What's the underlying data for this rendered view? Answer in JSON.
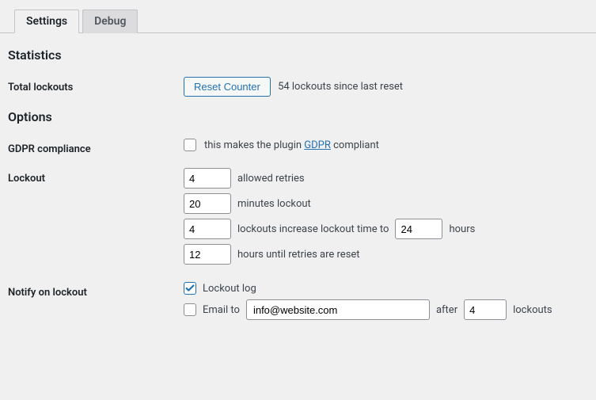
{
  "tabs": {
    "settings": "Settings",
    "debug": "Debug"
  },
  "sections": {
    "statistics": "Statistics",
    "options": "Options"
  },
  "total_lockouts": {
    "label": "Total lockouts",
    "button": "Reset Counter",
    "text": "54 lockouts since last reset"
  },
  "gdpr": {
    "label": "GDPR compliance",
    "checked": false,
    "text_pre": "this makes the plugin ",
    "link": "GDPR",
    "text_post": " compliant"
  },
  "lockout": {
    "label": "Lockout",
    "retries": "4",
    "retries_label": "allowed retries",
    "minutes": "20",
    "minutes_label": "minutes lockout",
    "increase_count": "4",
    "increase_label_pre": "lockouts increase lockout time to",
    "increase_hours": "24",
    "increase_label_post": "hours",
    "reset_hours": "12",
    "reset_label": "hours until retries are reset"
  },
  "notify": {
    "label": "Notify on lockout",
    "log_checked": true,
    "log_label": "Lockout log",
    "email_checked": false,
    "email_label": "Email to",
    "email_value": "info@website.com",
    "after_label": "after",
    "after_count": "4",
    "lockouts_label": "lockouts"
  }
}
